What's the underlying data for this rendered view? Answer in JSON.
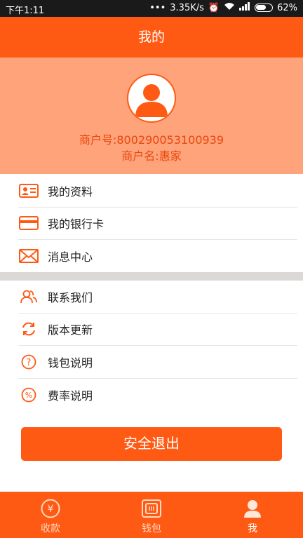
{
  "status_bar": {
    "time": "下午1:11",
    "network_speed": "3.35K/s",
    "battery": "62%"
  },
  "header": {
    "title": "我的"
  },
  "profile": {
    "merchant_no": "商户号:800290053100939",
    "merchant_name": "商户名:惠家"
  },
  "menu_group_1": [
    {
      "label": "我的资料",
      "icon": "id-card-icon"
    },
    {
      "label": "我的银行卡",
      "icon": "bank-card-icon"
    },
    {
      "label": "消息中心",
      "icon": "envelope-icon"
    }
  ],
  "menu_group_2": [
    {
      "label": "联系我们",
      "icon": "contacts-icon"
    },
    {
      "label": "版本更新",
      "icon": "refresh-icon"
    },
    {
      "label": "钱包说明",
      "icon": "question-icon"
    },
    {
      "label": "费率说明",
      "icon": "percent-icon"
    }
  ],
  "logout_label": "安全退出",
  "tabs": [
    {
      "label": "收款",
      "icon": "yen-icon",
      "active": false
    },
    {
      "label": "钱包",
      "icon": "wallet-icon",
      "active": false
    },
    {
      "label": "我",
      "icon": "user-icon",
      "active": true
    }
  ],
  "colors": {
    "primary": "#ff5a14",
    "profile_bg": "#ffa37a",
    "merchant_text": "#e8470c"
  }
}
